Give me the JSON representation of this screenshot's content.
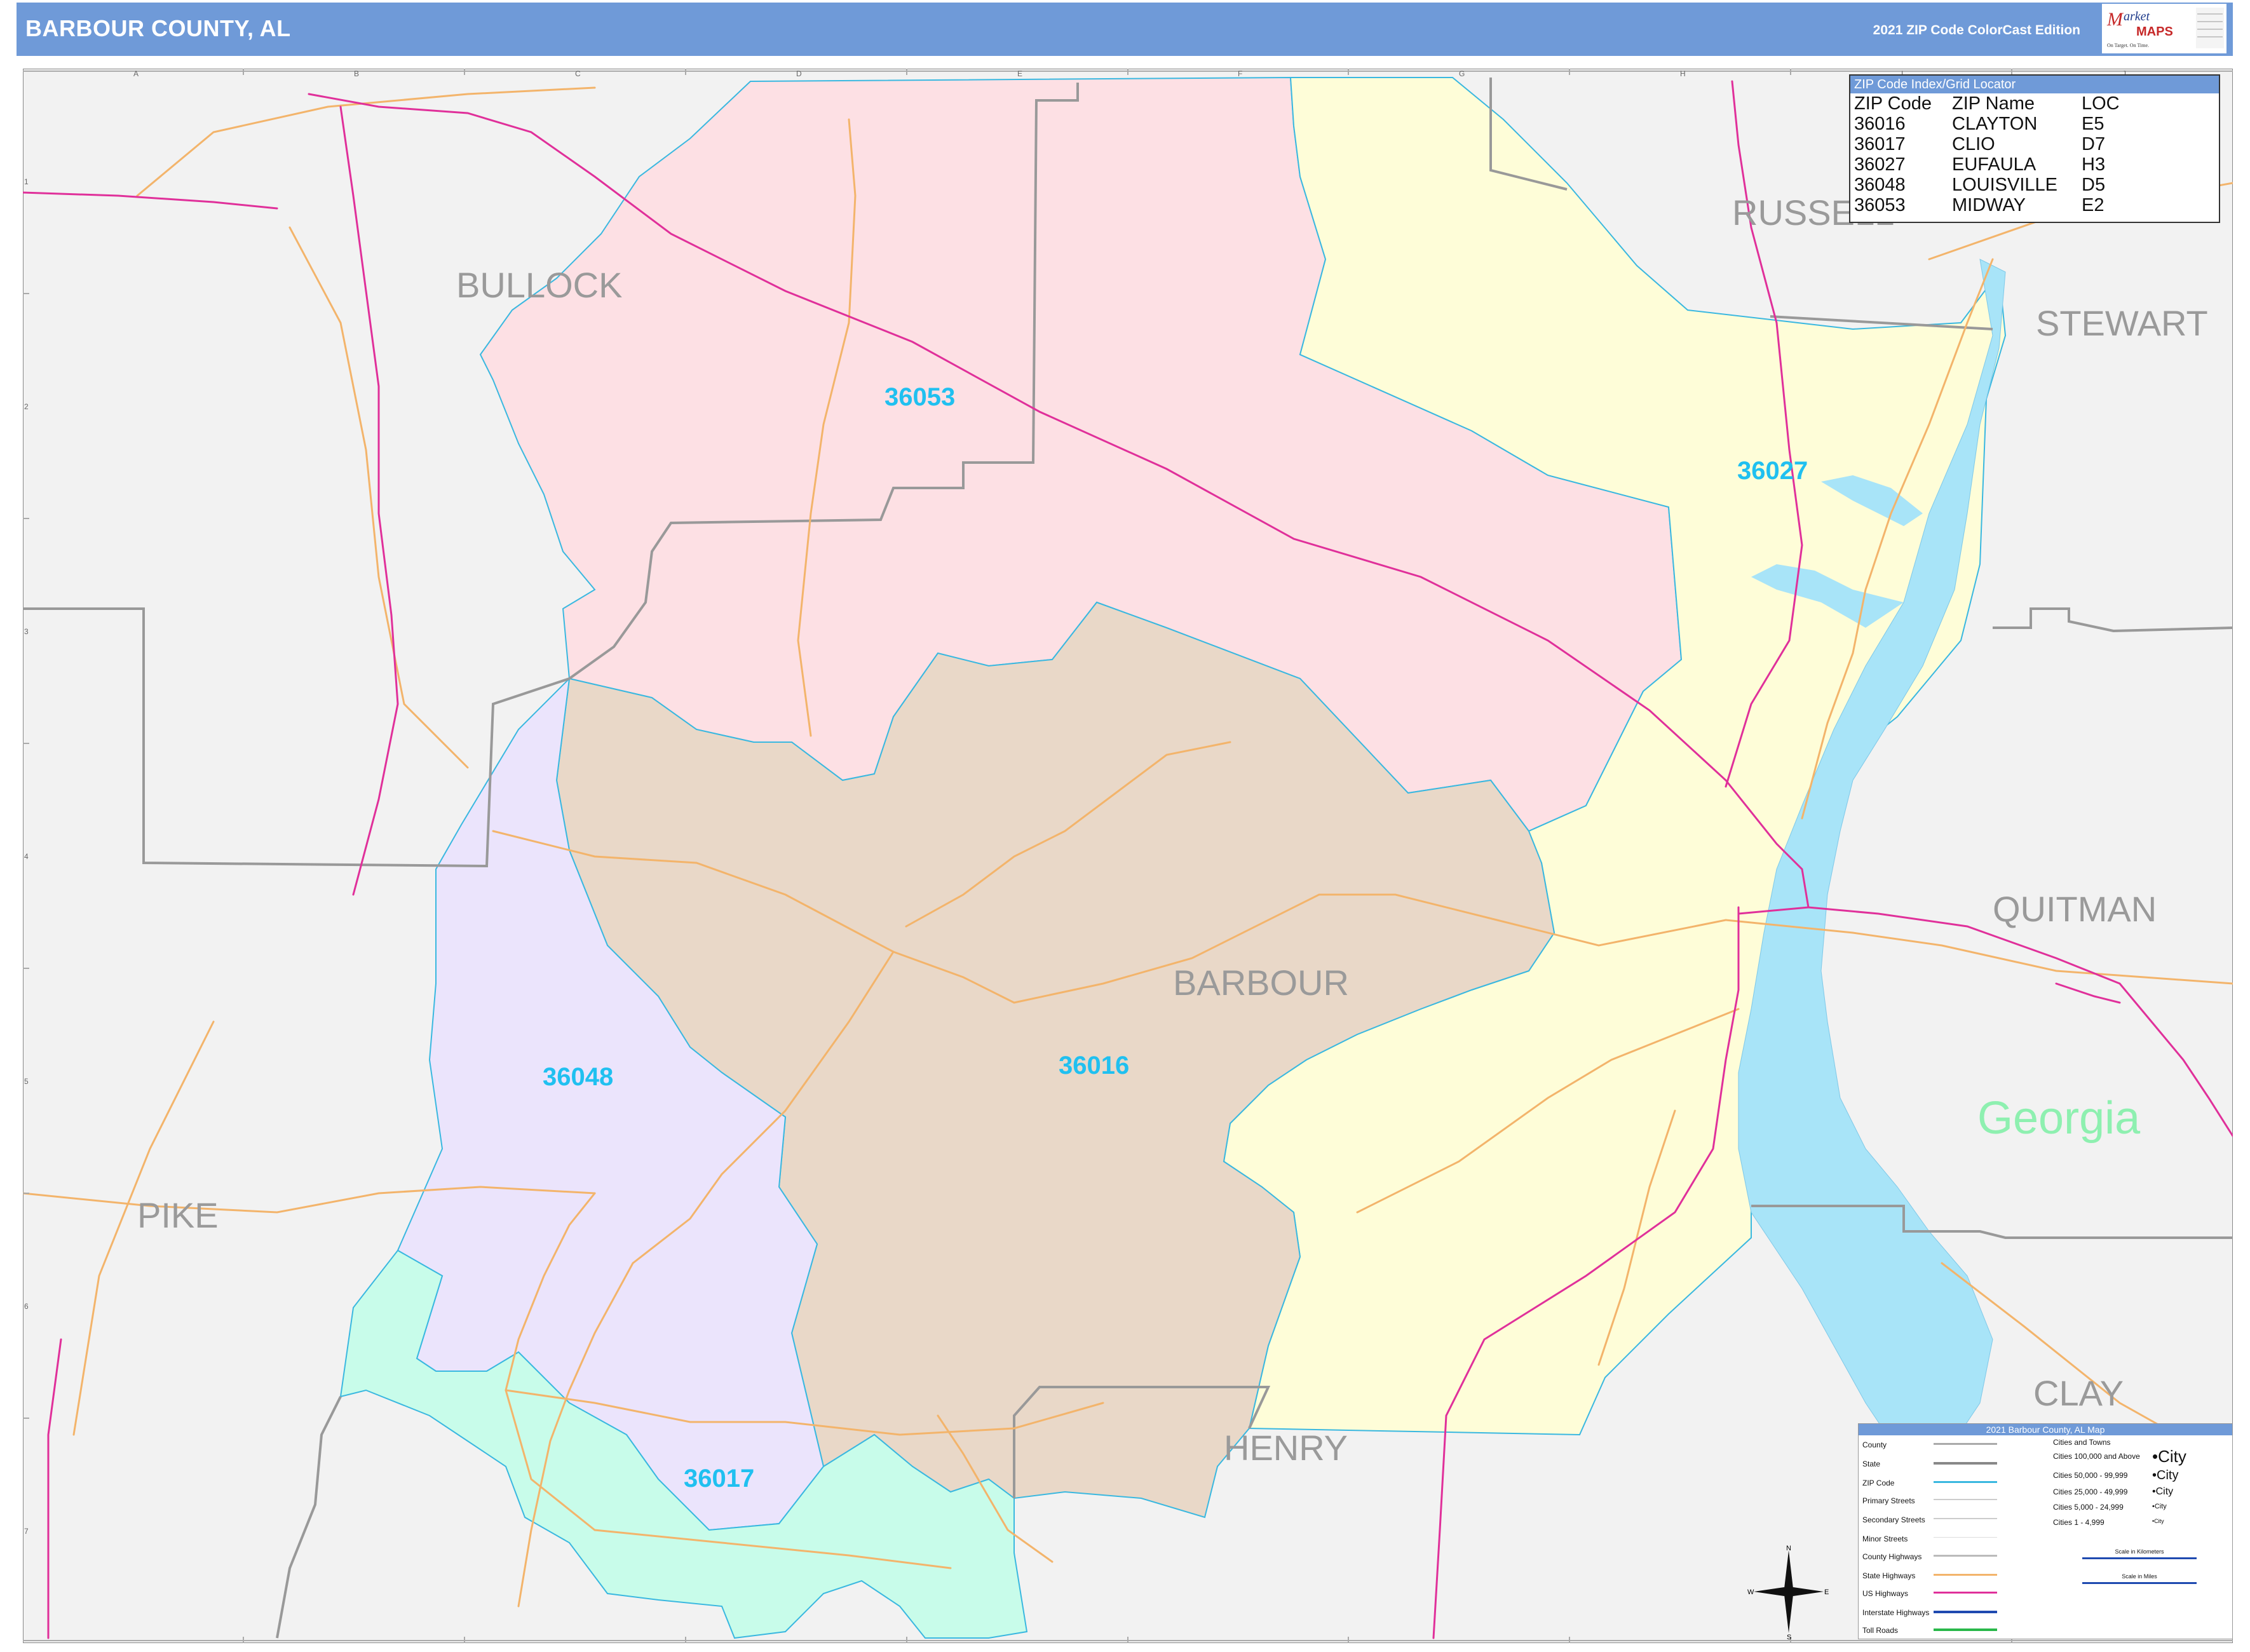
{
  "header": {
    "title": "BARBOUR COUNTY, AL",
    "edition": "2021 ZIP Code ColorCast Edition",
    "logo_text": "Market MAPS",
    "logo_tagline": "On Target. On Time. America's Leading Source of Business Maps"
  },
  "zip_index": {
    "title": "ZIP Code Index/Grid Locator",
    "columns": [
      "ZIP Code",
      "ZIP Name",
      "LOC"
    ],
    "rows": [
      [
        "36016",
        "CLAYTON",
        "E5"
      ],
      [
        "36017",
        "CLIO",
        "D7"
      ],
      [
        "36027",
        "EUFAULA",
        "H3"
      ],
      [
        "36048",
        "LOUISVILLE",
        "D5"
      ],
      [
        "36053",
        "MIDWAY",
        "E2"
      ]
    ]
  },
  "zip_labels": [
    "36053",
    "36027",
    "36016",
    "36048",
    "36017"
  ],
  "county_labels": {
    "bullock": "BULLOCK",
    "russell": "RUSSELL",
    "stewart": "STEWART",
    "barbour": "BARBOUR",
    "quitman": "QUITMAN",
    "pike": "PIKE",
    "henry": "HENRY",
    "clay": "CLAY"
  },
  "state_label": "Georgia",
  "grid": {
    "columns": [
      "A",
      "B",
      "C",
      "D",
      "E",
      "F",
      "G",
      "H",
      "I",
      "J"
    ],
    "rows": [
      "1",
      "2",
      "3",
      "4",
      "5",
      "6",
      "7"
    ]
  },
  "zip_colors": {
    "36053": "#fde0e4",
    "36027": "#fefdd8",
    "36016": "#e9d8c8",
    "36048": "#ebe4fc",
    "36017": "#c8fcea",
    "background": "#f2f2f2",
    "water": "#a8e4f8",
    "zip_boundary": "#3ab8e0",
    "label": "#20c0f0"
  },
  "legend": {
    "title": "2021 Barbour County, AL Map",
    "items": [
      "County",
      "State",
      "ZIP Code",
      "Primary Streets",
      "Secondary Streets",
      "Minor Streets",
      "County Highways",
      "State Highways",
      "US Highways",
      "Interstate Highways",
      "Toll Roads"
    ],
    "cities_title": "Cities and Towns",
    "cities": [
      {
        "range": "Cities 100,000 and Above",
        "sample": "City"
      },
      {
        "range": "Cities 50,000 - 99,999",
        "sample": "City"
      },
      {
        "range": "Cities 25,000 - 49,999",
        "sample": "City"
      },
      {
        "range": "Cities 5,000 - 24,999",
        "sample": "City"
      },
      {
        "range": "Cities 1 - 4,999",
        "sample": "City"
      }
    ],
    "scale_km": "Scale in Kilometers",
    "scale_mi": "Scale in Miles"
  },
  "compass": {
    "n": "N",
    "s": "S",
    "e": "E",
    "w": "W"
  }
}
